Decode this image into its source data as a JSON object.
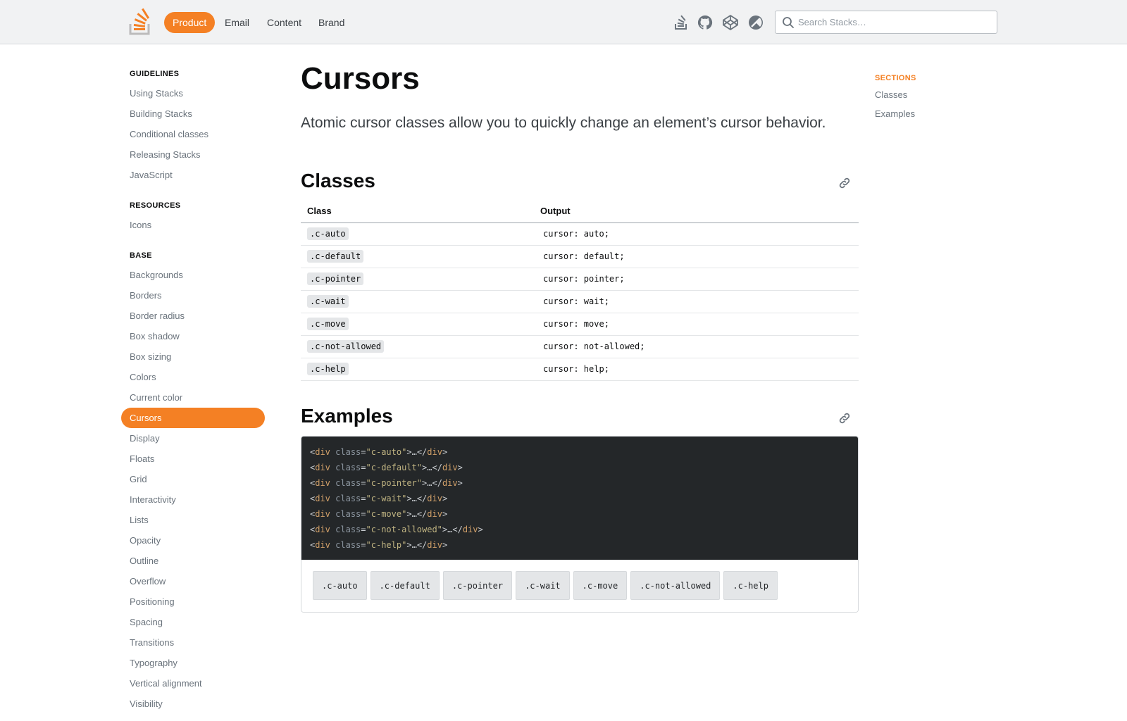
{
  "header": {
    "logo_icon": "stackoverflow-logo-icon",
    "tabs": [
      {
        "label": "Product",
        "active": true
      },
      {
        "label": "Email",
        "active": false
      },
      {
        "label": "Content",
        "active": false
      },
      {
        "label": "Brand",
        "active": false
      }
    ],
    "icons": [
      "stack-overflow-icon",
      "github-icon",
      "codepen-icon",
      "theme-toggle-icon"
    ],
    "search": {
      "placeholder": "Search Stacks…",
      "value": ""
    }
  },
  "sidebar": {
    "sections": [
      {
        "heading": "GUIDELINES",
        "items": [
          "Using Stacks",
          "Building Stacks",
          "Conditional classes",
          "Releasing Stacks",
          "JavaScript"
        ]
      },
      {
        "heading": "RESOURCES",
        "items": [
          "Icons"
        ]
      },
      {
        "heading": "BASE",
        "items": [
          "Backgrounds",
          "Borders",
          "Border radius",
          "Box shadow",
          "Box sizing",
          "Colors",
          "Current color",
          "Cursors",
          "Display",
          "Floats",
          "Grid",
          "Interactivity",
          "Lists",
          "Opacity",
          "Outline",
          "Overflow",
          "Positioning",
          "Spacing",
          "Transitions",
          "Typography",
          "Vertical alignment",
          "Visibility"
        ]
      }
    ],
    "active_item": "Cursors"
  },
  "main": {
    "title": "Cursors",
    "lead": "Atomic cursor classes allow you to quickly change an element’s cursor behavior.",
    "classes_section": {
      "heading": "Classes",
      "columns": [
        "Class",
        "Output"
      ],
      "rows": [
        {
          "class": ".c-auto",
          "output": "cursor: auto;"
        },
        {
          "class": ".c-default",
          "output": "cursor: default;"
        },
        {
          "class": ".c-pointer",
          "output": "cursor: pointer;"
        },
        {
          "class": ".c-wait",
          "output": "cursor: wait;"
        },
        {
          "class": ".c-move",
          "output": "cursor: move;"
        },
        {
          "class": ".c-not-allowed",
          "output": "cursor: not-allowed;"
        },
        {
          "class": ".c-help",
          "output": "cursor: help;"
        }
      ]
    },
    "examples_section": {
      "heading": "Examples",
      "code_lines": [
        {
          "cls": "c-auto"
        },
        {
          "cls": "c-default"
        },
        {
          "cls": "c-pointer"
        },
        {
          "cls": "c-wait"
        },
        {
          "cls": "c-move"
        },
        {
          "cls": "c-not-allowed"
        },
        {
          "cls": "c-help"
        }
      ],
      "code_tokens": {
        "open": "<",
        "tag": "div",
        "attr": "class",
        "eq": "=",
        "quote": "\"",
        "close": ">",
        "ellipsis": "…",
        "end_open": "</"
      },
      "demo_boxes": [
        ".c-auto",
        ".c-default",
        ".c-pointer",
        ".c-wait",
        ".c-move",
        ".c-not-allowed",
        ".c-help"
      ]
    }
  },
  "toc": {
    "heading": "SECTIONS",
    "items": [
      "Classes",
      "Examples"
    ]
  },
  "colors": {
    "accent": "#f48024",
    "code_bg": "#242729"
  }
}
